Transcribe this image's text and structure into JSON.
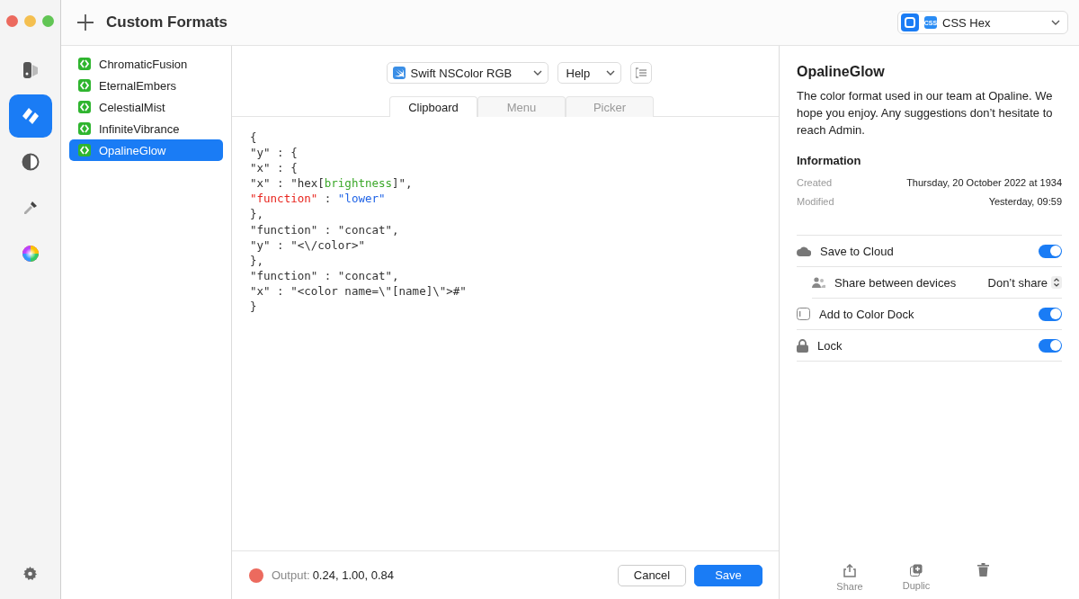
{
  "window": {
    "title": "Custom Formats"
  },
  "rail": {
    "items": [
      {
        "selected": false
      },
      {
        "selected": true
      },
      {
        "selected": false
      },
      {
        "selected": false
      },
      {
        "selected": false
      }
    ]
  },
  "format_picker": {
    "badge": "CSS",
    "value": "CSS Hex"
  },
  "formats": [
    {
      "name": "ChromaticFusion",
      "selected": false
    },
    {
      "name": "EternalEmbers",
      "selected": false
    },
    {
      "name": "CelestialMist",
      "selected": false
    },
    {
      "name": "InfiniteVibrance",
      "selected": false
    },
    {
      "name": "OpalineGlow",
      "selected": true
    }
  ],
  "editor": {
    "language": "Swift NSColor RGB",
    "help": "Help",
    "tabs": [
      {
        "label": "Clipboard",
        "selected": true
      },
      {
        "label": "Menu",
        "selected": false
      },
      {
        "label": "Picker",
        "selected": false
      }
    ],
    "code": [
      [
        {
          "text": "{",
          "kind": "plain"
        }
      ],
      [
        {
          "text": "\"y\" : {",
          "kind": "plain"
        }
      ],
      [
        {
          "text": "\"x\" : {",
          "kind": "plain"
        }
      ],
      [
        {
          "text": "\"x\" : \"hex[",
          "kind": "plain"
        },
        {
          "text": "brightness",
          "kind": "param"
        },
        {
          "text": "]\",",
          "kind": "plain"
        }
      ],
      [
        {
          "text": "\"function\"",
          "kind": "key"
        },
        {
          "text": " : ",
          "kind": "plain"
        },
        {
          "text": "\"lower\"",
          "kind": "string"
        }
      ],
      [
        {
          "text": "},",
          "kind": "plain"
        }
      ],
      [
        {
          "text": "\"function\" : \"concat\",",
          "kind": "plain"
        }
      ],
      [
        {
          "text": "\"y\" : \"<\\/color>\"",
          "kind": "plain"
        }
      ],
      [
        {
          "text": "},",
          "kind": "plain"
        }
      ],
      [
        {
          "text": "\"function\" : \"concat\",",
          "kind": "plain"
        }
      ],
      [
        {
          "text": "\"x\" : \"<color name=\\\"[name]\\\">#\"",
          "kind": "plain"
        }
      ],
      [
        {
          "text": "}",
          "kind": "plain"
        }
      ]
    ],
    "output": {
      "label": "Output:",
      "value": "0.24, 1.00, 0.84",
      "color": "#ec6a5e"
    },
    "buttons": [
      "Cancel",
      "Save"
    ]
  },
  "details": {
    "title": "OpalineGlow",
    "description": "The color format used in our team at Opaline. We hope you enjoy. Any suggestions don’t hesitate to reach Admin.",
    "info_heading": "Information",
    "info": [
      {
        "label": "Created",
        "value": "Thursday, 20 October 2022 at 1934"
      },
      {
        "label": "Modified",
        "value": "Yesterday, 09:59"
      }
    ],
    "settings": [
      {
        "kind": "toggle",
        "label": "Save to Cloud",
        "on": true
      },
      {
        "kind": "select",
        "label": "Share between devices",
        "value": "Don’t share"
      },
      {
        "kind": "toggle",
        "label": "Add to Color Dock",
        "on": true
      },
      {
        "kind": "toggle",
        "label": "Lock",
        "on": true
      }
    ],
    "actions": [
      "Share",
      "Duplic"
    ]
  }
}
